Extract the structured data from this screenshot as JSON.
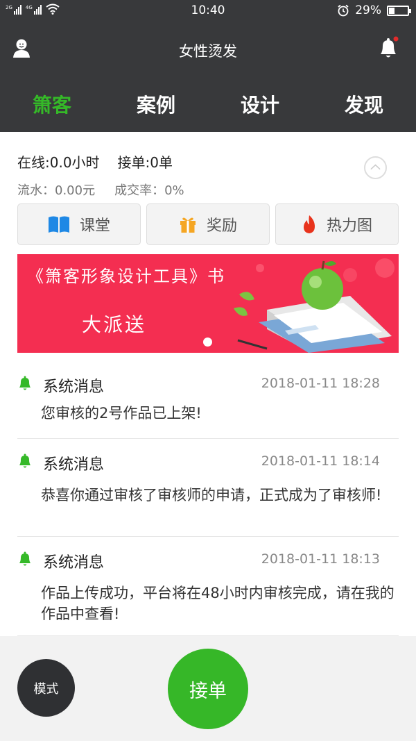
{
  "status_bar": {
    "time": "10:40",
    "battery": "29%",
    "battery_level": 0.29,
    "signal_labels": [
      "2G",
      "4G"
    ]
  },
  "header": {
    "title": "女性烫发",
    "tabs": [
      {
        "label": "箫客",
        "active": true
      },
      {
        "label": "案例",
        "active": false
      },
      {
        "label": "设计",
        "active": false
      },
      {
        "label": "发现",
        "active": false
      }
    ]
  },
  "stats": {
    "online": "在线:0.0小时",
    "orders": "接单:0单",
    "revenue": "流水：0.00元",
    "conversion": "成交率：0%"
  },
  "quick_actions": [
    {
      "label": "课堂",
      "icon": "book-icon"
    },
    {
      "label": "奖励",
      "icon": "gift-icon"
    },
    {
      "label": "热力图",
      "icon": "flame-icon"
    }
  ],
  "banner": {
    "line1": "《箫客形象设计工具》书",
    "line2": "大派送"
  },
  "messages": [
    {
      "title": "系统消息",
      "time": "2018-01-11 18:28",
      "body": "您审核的2号作品已上架!"
    },
    {
      "title": "系统消息",
      "time": "2018-01-11 18:14",
      "body": "恭喜你通过审核了审核师的申请，正式成为了审核师!"
    },
    {
      "title": "系统消息",
      "time": "2018-01-11 18:13",
      "body": "作品上传成功，平台将在48小时内审核完成，请在我的作品中查看!"
    }
  ],
  "bottom": {
    "mode_label": "模式",
    "accept_label": "接单"
  },
  "colors": {
    "accent_green": "#35b928",
    "header_bg": "#38393b",
    "banner_red": "#f42e51",
    "notification_dot": "#e32b2b"
  }
}
